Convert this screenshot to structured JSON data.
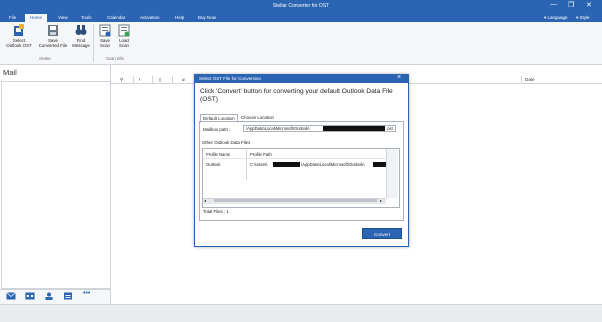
{
  "app": {
    "title": "Stellar Converter for OST"
  },
  "window": {
    "minimize": "—",
    "restore": "❐",
    "close": "✕"
  },
  "menu": {
    "items": [
      "File",
      "Home",
      "View",
      "Tools",
      "Calendar",
      "Activation",
      "Help",
      "Buy Now"
    ],
    "language": "Language",
    "style": "Style"
  },
  "ribbon": {
    "buttons": [
      {
        "label1": "Select",
        "label2": "Outlook OST"
      },
      {
        "label1": "Save",
        "label2": "Converted File"
      },
      {
        "label1": "Find",
        "label2": "Message"
      },
      {
        "label1": "Save",
        "label2": "Scan"
      },
      {
        "label1": "Load",
        "label2": "Scan"
      }
    ],
    "groups": [
      "Home",
      "Scan Info"
    ]
  },
  "left": {
    "title": "Mail"
  },
  "list": {
    "date_header": "Date"
  },
  "dialog": {
    "title": "Select OST File for Conversion",
    "heading": "Click 'Convert' button for converting your default Outlook Data File (OST)",
    "tabs": [
      "Default Location",
      "Choose Location"
    ],
    "mailbox_label": "Mailbox path :",
    "mailbox_value_start": "\\AppData\\Local\\Microsoft\\Outlook\\",
    "mailbox_value_end": ".ost",
    "other_label": "Other Outlook Data Files",
    "columns": [
      "Profile Name",
      "Profile Path"
    ],
    "rows": [
      {
        "name": "Outlook",
        "path_start": "C:\\Users\\",
        "path_mid": "\\AppData\\Local\\Microsoft\\Outlook\\"
      }
    ],
    "total": "Total Files : 1",
    "convert": "Convert"
  }
}
